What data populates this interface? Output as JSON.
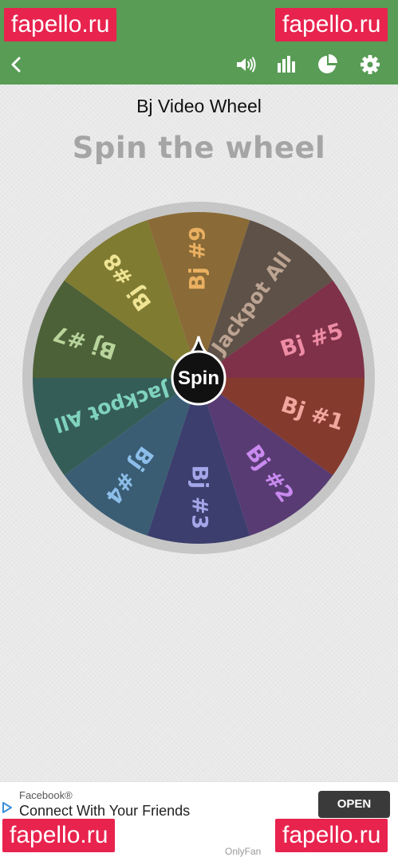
{
  "header": {
    "back": "back-arrow-icon",
    "color": "#589c55"
  },
  "toolbar": [
    "volume-icon",
    "stats-icon",
    "pie-chart-icon",
    "gear-icon"
  ],
  "wheel_name": "Bj Video Wheel",
  "headline": "Spin the wheel",
  "spin_label": "Spin",
  "wheel": {
    "segments": [
      {
        "label": "Bj #9",
        "color": "#8a6b37",
        "text_color": "#eab061"
      },
      {
        "label": "Jackpot All",
        "color": "#5e5147",
        "text_color": "#bca392"
      },
      {
        "label": "Bj #5",
        "color": "#7e3148",
        "text_color": "#ee8ca6"
      },
      {
        "label": "Bj #1",
        "color": "#843a2d",
        "text_color": "#f1a69e"
      },
      {
        "label": "Bj #2",
        "color": "#583b73",
        "text_color": "#c98aef"
      },
      {
        "label": "Bj #3",
        "color": "#3c3e6d",
        "text_color": "#a3a6e8"
      },
      {
        "label": "Bj #4",
        "color": "#3a5d74",
        "text_color": "#8cbee9"
      },
      {
        "label": "Jackpot All",
        "color": "#355d57",
        "text_color": "#7fd3bc"
      },
      {
        "label": "Bj #7",
        "color": "#4d6138",
        "text_color": "#b8d49b"
      },
      {
        "label": "Bj #8",
        "color": "#7f7b31",
        "text_color": "#efe494"
      }
    ]
  },
  "ad": {
    "source": "Facebook®",
    "title": "Connect With Your Friends",
    "button": "OPEN",
    "footer": "OnlyFan"
  },
  "watermarks": [
    "fapello.ru",
    "fapello.ru",
    "fapello.ru",
    "fapello.ru"
  ]
}
